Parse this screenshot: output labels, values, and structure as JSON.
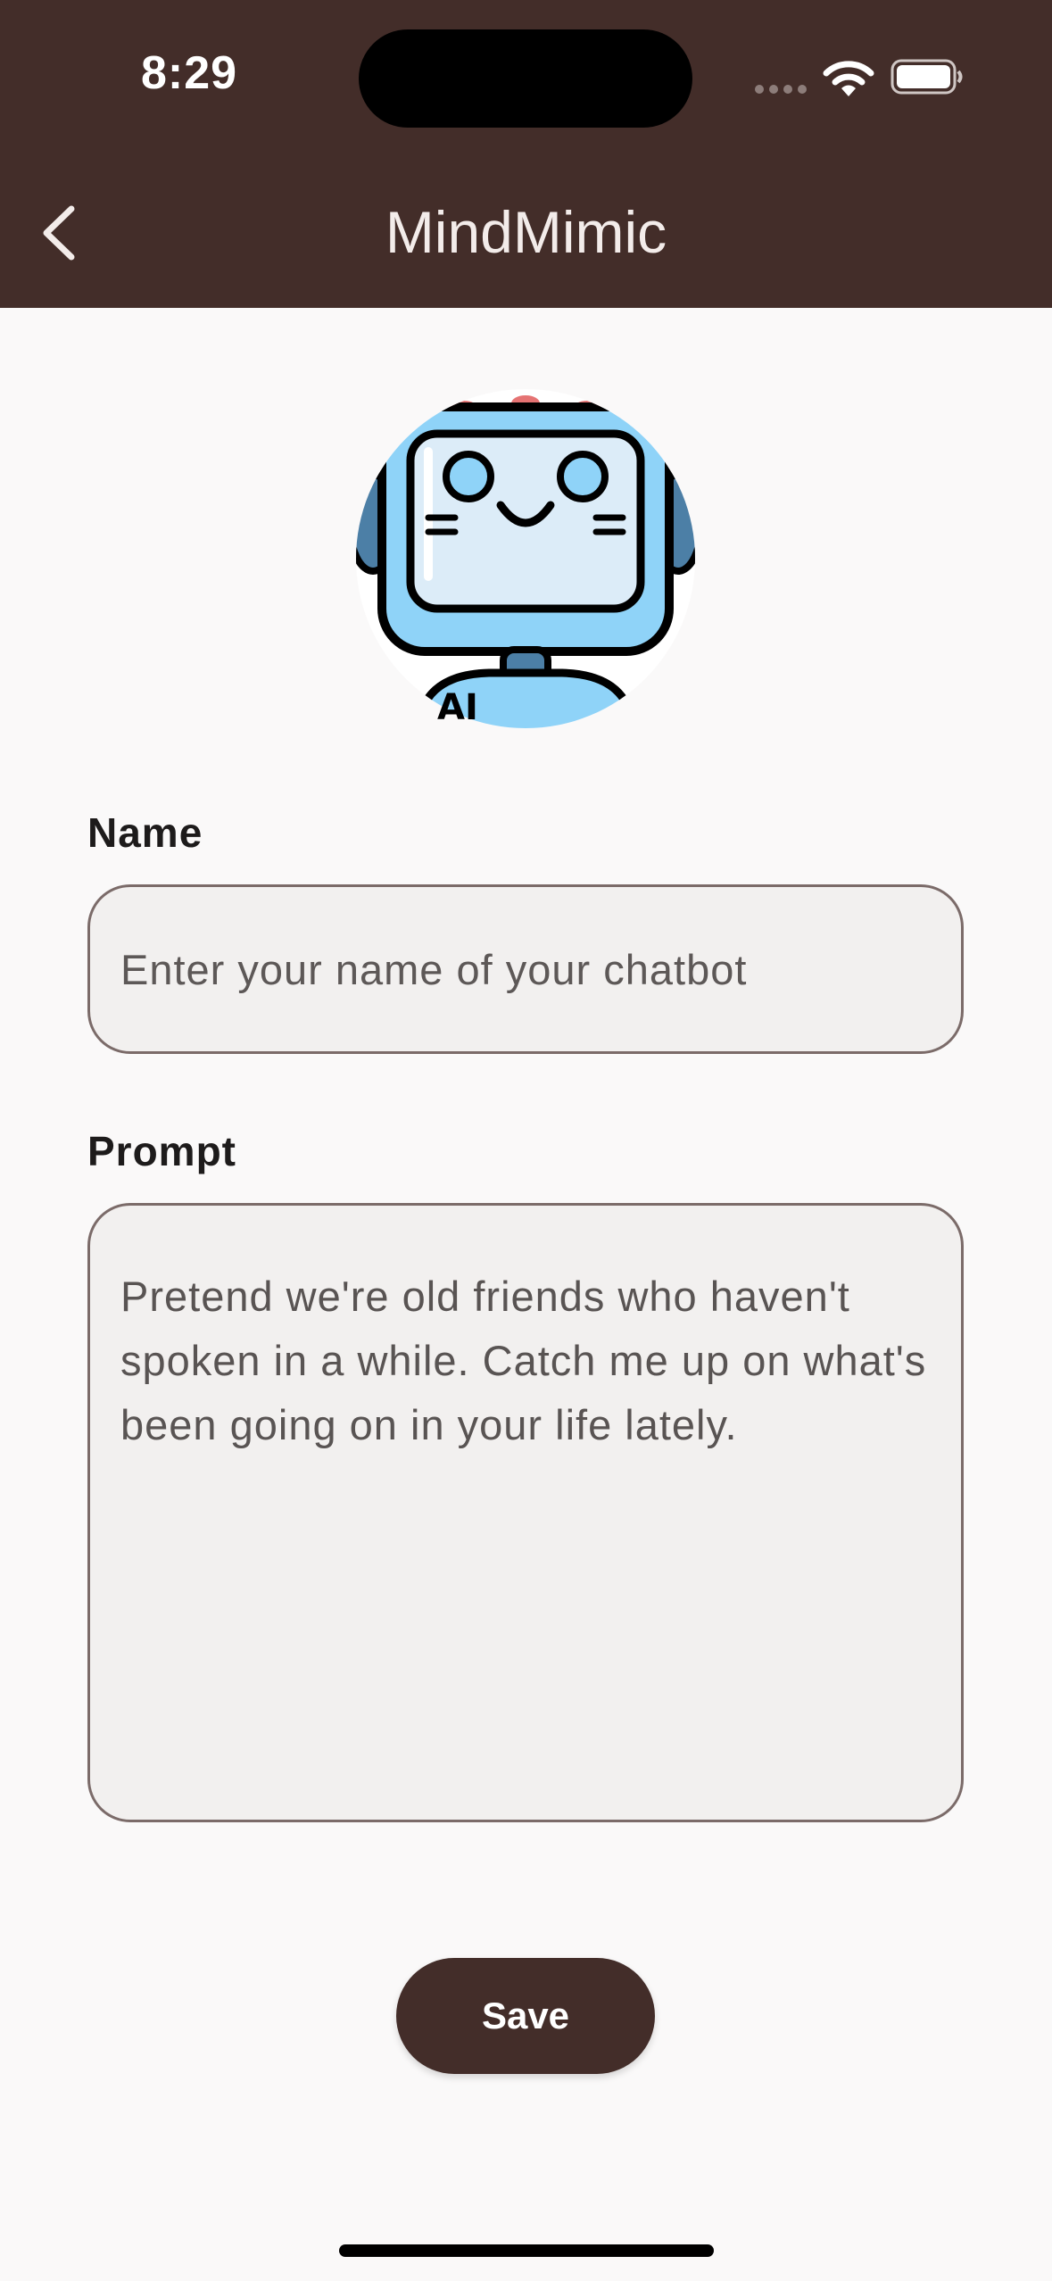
{
  "status_bar": {
    "time": "8:29"
  },
  "header": {
    "title": "MindMimic",
    "back_icon": "chevron-left-icon"
  },
  "avatar": {
    "badge_text": "AI",
    "icon": "robot-icon"
  },
  "form": {
    "name_label": "Name",
    "name_placeholder": "Enter your name of your chatbot",
    "prompt_label": "Prompt",
    "prompt_value": "Pretend we're old friends who haven't spoken in a while. Catch me up on what's been going on in your life lately."
  },
  "actions": {
    "save_label": "Save"
  },
  "colors": {
    "primary": "#432d29",
    "field_bg": "#f2f0ef",
    "field_border": "#7b6b69",
    "background": "#faf9f9"
  }
}
